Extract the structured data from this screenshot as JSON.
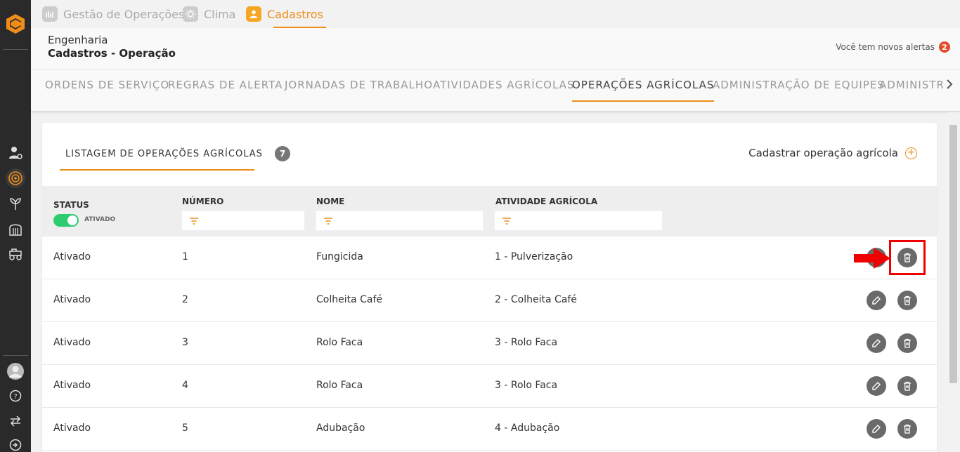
{
  "modules": [
    {
      "label": "Gestão de Operações",
      "icon": "operations-icon",
      "active": false
    },
    {
      "label": "Clima",
      "icon": "sun-icon",
      "active": false
    },
    {
      "label": "Cadastros",
      "icon": "user-icon",
      "active": true
    }
  ],
  "header": {
    "breadcrumb_parent": "Engenharia",
    "breadcrumb_current": "Cadastros - Operação",
    "alerts_text": "Você tem novos alertas",
    "alerts_count": "2"
  },
  "tabs": [
    {
      "label": "ORDENS DE SERVIÇO",
      "active": false
    },
    {
      "label": "REGRAS DE ALERTA",
      "active": false
    },
    {
      "label": "JORNADAS DE TRABALHO",
      "active": false
    },
    {
      "label": "ATIVIDADES AGRÍCOLAS",
      "active": false
    },
    {
      "label": "OPERAÇÕES AGRÍCOLAS",
      "active": true
    },
    {
      "label": "ADMINISTRAÇÃO DE EQUIPES",
      "active": false
    },
    {
      "label": "ADMINISTR",
      "active": false
    }
  ],
  "list": {
    "title": "LISTAGEM DE OPERAÇÕES AGRÍCOLAS",
    "count": "7",
    "add_label": "Cadastrar operação agrícola"
  },
  "table": {
    "headers": {
      "status": "STATUS",
      "numero": "NÚMERO",
      "nome": "NOME",
      "atividade": "ATIVIDADE AGRÍCOLA"
    },
    "status_toggle_label": "ATIVADO",
    "rows": [
      {
        "status": "Ativado",
        "numero": "1",
        "nome": "Fungicida",
        "atividade": "1 - Pulverização"
      },
      {
        "status": "Ativado",
        "numero": "2",
        "nome": "Colheita Café",
        "atividade": "2 - Colheita Café"
      },
      {
        "status": "Ativado",
        "numero": "3",
        "nome": "Rolo Faca",
        "atividade": "3 - Rolo Faca"
      },
      {
        "status": "Ativado",
        "numero": "4",
        "nome": "Rolo Faca",
        "atividade": "3 - Rolo Faca"
      },
      {
        "status": "Ativado",
        "numero": "5",
        "nome": "Adubação",
        "atividade": "4 - Adubação"
      }
    ]
  },
  "colors": {
    "accent": "#f08c1a",
    "rail": "#2a2a2a",
    "toggle_on": "#2ecc71",
    "alert_badge": "#e84b2c",
    "highlight": "#ee0000"
  }
}
